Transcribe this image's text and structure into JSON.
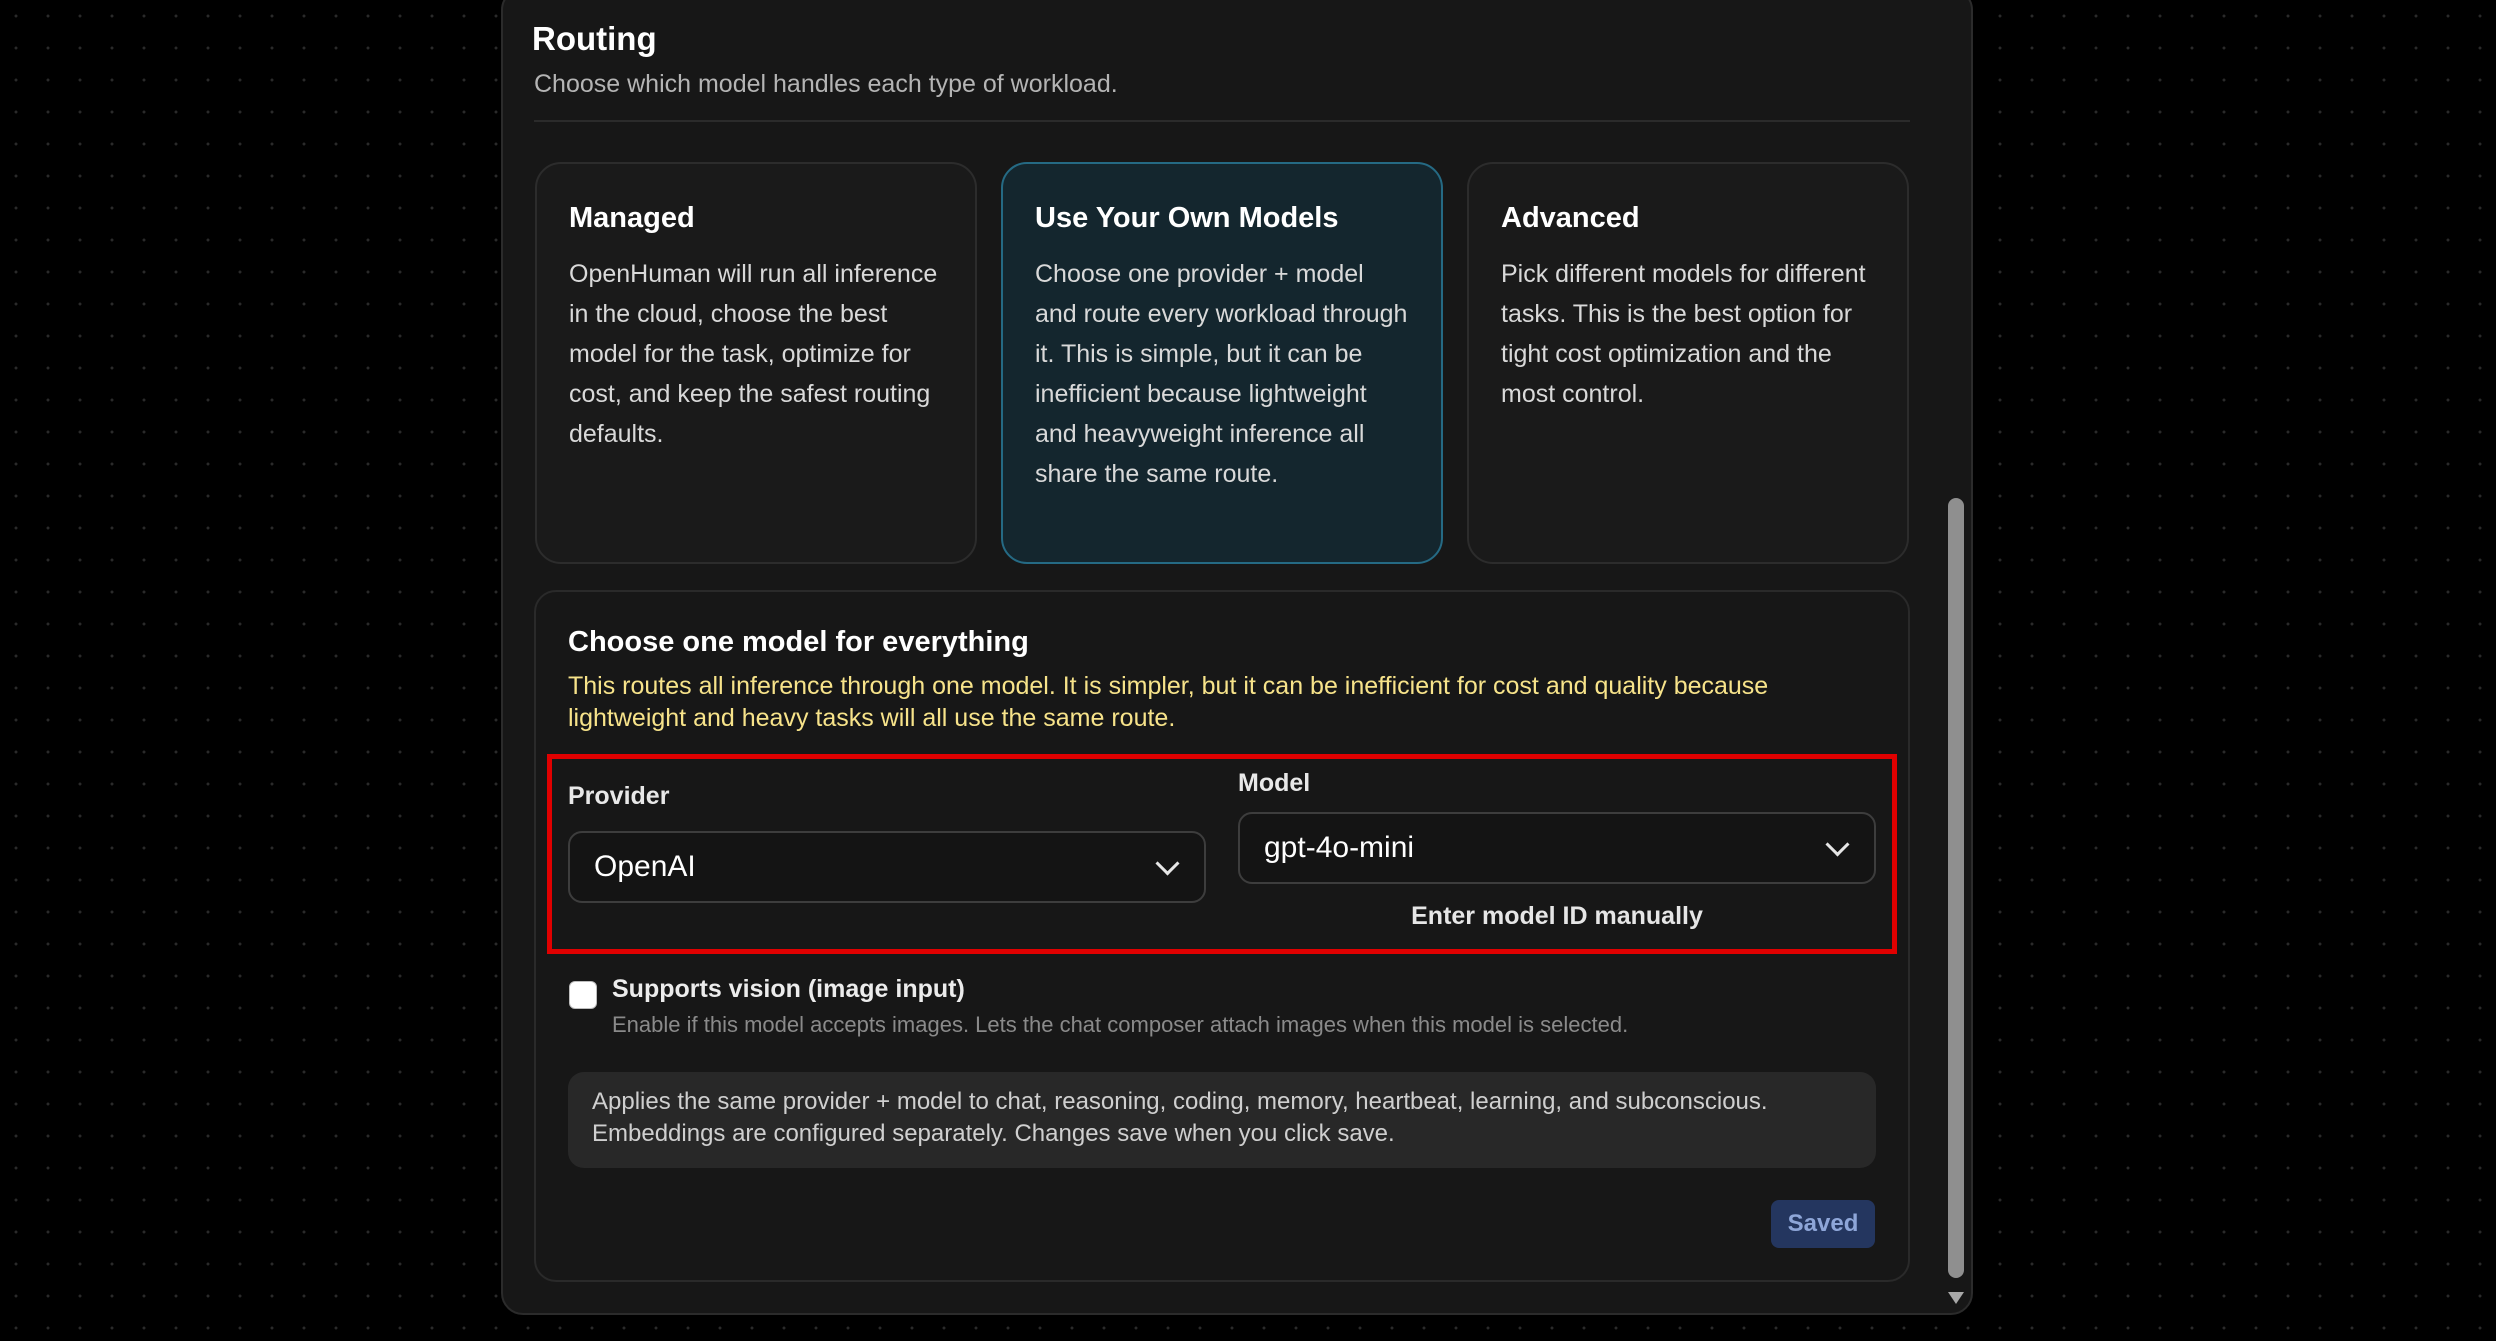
{
  "routing": {
    "title": "Routing",
    "subtitle": "Choose which model handles each type of workload."
  },
  "modes": [
    {
      "title": "Managed",
      "description": "OpenHuman will run all inference in the cloud, choose the best model for the task, optimize for cost, and keep the safest routing defaults.",
      "selected": false
    },
    {
      "title": "Use Your Own Models",
      "description": "Choose one provider + model and route every workload through it. This is simple, but it can be inefficient because lightweight and heavyweight inference all share the same route.",
      "selected": true
    },
    {
      "title": "Advanced",
      "description": "Pick different models for different tasks. This is the best option for tight cost optimization and the most control.",
      "selected": false
    }
  ],
  "single_model": {
    "title": "Choose one model for everything",
    "warning": "This routes all inference through one model. It is simpler, but it can be inefficient for cost and quality because lightweight and heavy tasks will all use the same route.",
    "provider_label": "Provider",
    "provider_value": "OpenAI",
    "model_label": "Model",
    "model_value": "gpt-4o-mini",
    "manual_link": "Enter model ID manually",
    "vision_label": "Supports vision (image input)",
    "vision_help": "Enable if this model accepts images. Lets the chat composer attach images when this model is selected.",
    "vision_checked": false,
    "info": "Applies the same provider + model to chat, reasoning, coding, memory, heartbeat, learning, and subconscious. Embeddings are configured separately. Changes save when you click save.",
    "save_label": "Saved"
  },
  "colors": {
    "accent_border": "#256a84",
    "warning": "#f7e38a",
    "highlight": "#e00000",
    "save_button": "#24365f"
  },
  "icons": {
    "select": "chevron-down-icon",
    "scroll": "scroll-down-arrow-icon"
  }
}
